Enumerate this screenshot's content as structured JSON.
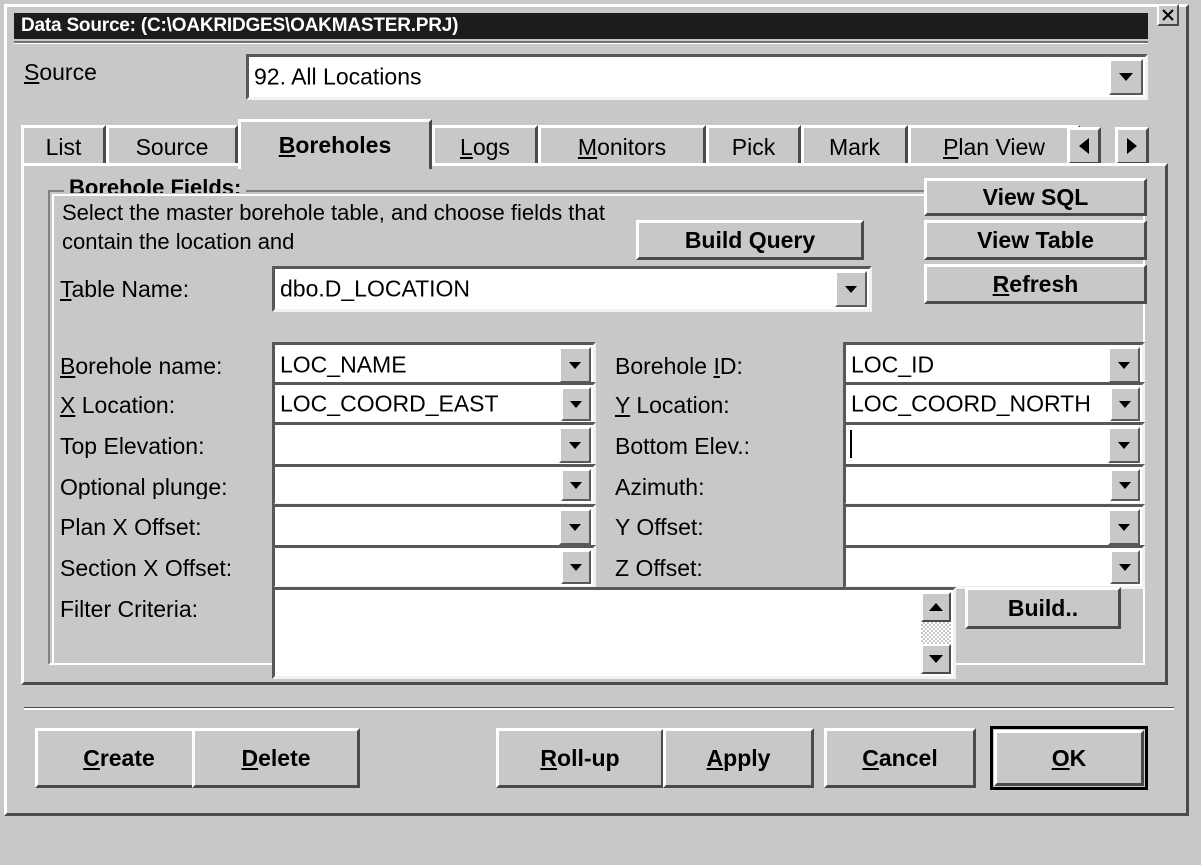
{
  "window": {
    "title": "Data Source: (C:\\OAKRIDGES\\OAKMASTER.PRJ)",
    "close_label": "⌧"
  },
  "source": {
    "label": "Source",
    "label_mnemonic": "S",
    "value": "92. All Locations"
  },
  "tabs": {
    "items": [
      {
        "label": "List",
        "mnemonic": "",
        "active": false
      },
      {
        "label": "Source",
        "mnemonic": "",
        "active": false
      },
      {
        "label": "Boreholes",
        "mnemonic": "B",
        "active": true
      },
      {
        "label": "Logs",
        "mnemonic": "L",
        "active": false
      },
      {
        "label": "Monitors",
        "mnemonic": "M",
        "active": false
      },
      {
        "label": "Pick",
        "mnemonic": "",
        "active": false
      },
      {
        "label": "Mark",
        "mnemonic": "",
        "active": false
      },
      {
        "label": "Plan View",
        "mnemonic": "P",
        "active": false
      }
    ],
    "scroll_left": "◄",
    "scroll_right": "►"
  },
  "group": {
    "title": "Borehole Fields:",
    "description": "Select the master borehole table, and choose fields that contain the location and"
  },
  "side_buttons": {
    "view_sql": "View SQL",
    "view_table": "View Table",
    "refresh": "Refresh",
    "refresh_mnemonic": "R",
    "build_query": "Build Query"
  },
  "table_name": {
    "label": "Table Name:",
    "label_mnemonic": "T",
    "value": "dbo.D_LOCATION"
  },
  "fields": {
    "left": [
      {
        "label": "Borehole name:",
        "mnemonic": "B",
        "value": "LOC_NAME"
      },
      {
        "label": "X Location:",
        "mnemonic": "X",
        "value": "LOC_COORD_EAST"
      },
      {
        "label": "Top Elevation:",
        "mnemonic": "",
        "value": ""
      },
      {
        "label": "Optional plunge:",
        "mnemonic": "",
        "value": ""
      },
      {
        "label": "Plan X Offset:",
        "mnemonic": "",
        "value": ""
      },
      {
        "label": "Section X Offset:",
        "mnemonic": "",
        "value": ""
      }
    ],
    "right": [
      {
        "label": "Borehole ID:",
        "mnemonic": "I",
        "value": "LOC_ID"
      },
      {
        "label": "Y Location:",
        "mnemonic": "Y",
        "value": "LOC_COORD_NORTH"
      },
      {
        "label": "Bottom Elev.:",
        "mnemonic": "",
        "value": ""
      },
      {
        "label": "Azimuth:",
        "mnemonic": "",
        "value": ""
      },
      {
        "label": "Y Offset:",
        "mnemonic": "",
        "value": ""
      },
      {
        "label": "Z Offset:",
        "mnemonic": "",
        "value": ""
      }
    ]
  },
  "filter": {
    "label": "Filter Criteria:",
    "value": "",
    "build_button": "Build.."
  },
  "footer": {
    "buttons": [
      {
        "label": "Create",
        "mnemonic": "C",
        "default": false
      },
      {
        "label": "Delete",
        "mnemonic": "D",
        "default": false
      },
      {
        "label": "Roll-up",
        "mnemonic": "R",
        "default": false
      },
      {
        "label": "Apply",
        "mnemonic": "A",
        "default": false
      },
      {
        "label": "Cancel",
        "mnemonic": "C",
        "default": false
      },
      {
        "label": "OK",
        "mnemonic": "O",
        "default": true
      }
    ]
  },
  "colors": {
    "face": "#c8c8c8",
    "titlebar": "#1c1c1c",
    "field_bg": "#ffffff",
    "shadow": "#4a4a4a",
    "highlight": "#ffffff"
  }
}
